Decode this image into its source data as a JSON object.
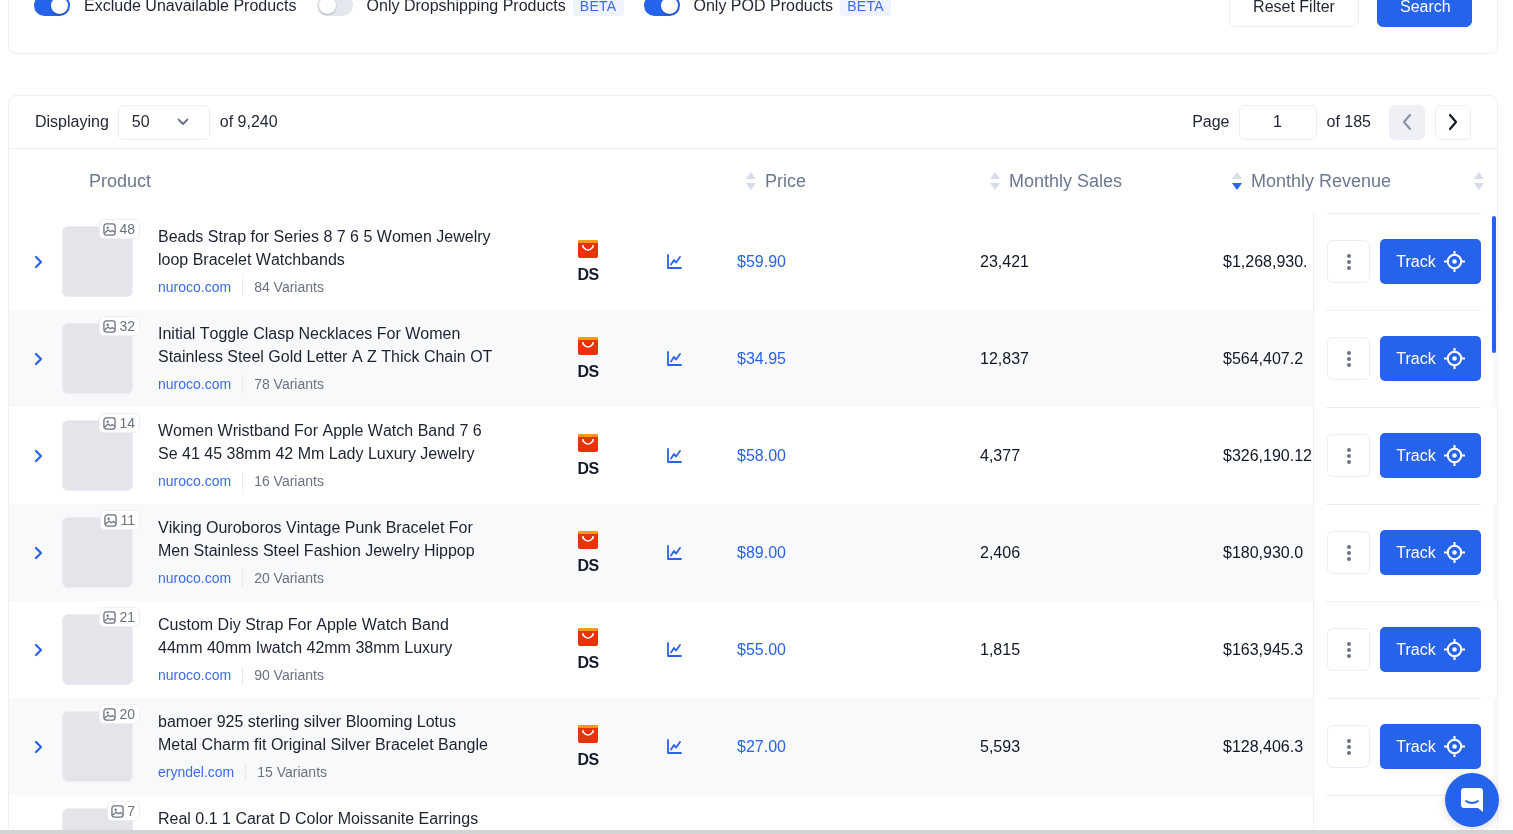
{
  "filters": {
    "toggles": [
      {
        "label": "Exclude Unavailable Products",
        "on": true
      },
      {
        "label": "Only Dropshipping Products",
        "on": false,
        "badge": "BETA"
      },
      {
        "label": "Only POD Products",
        "on": true,
        "badge": "BETA"
      }
    ],
    "buttons": [
      {
        "label": "Reset Filter",
        "kind": "secondary"
      },
      {
        "label": "Search",
        "kind": "primary"
      }
    ]
  },
  "results": {
    "displaying_label": "Displaying",
    "page_size": "50",
    "total": "of 9,240",
    "page_label": "Page",
    "page": "1",
    "page_total": "of 185",
    "prev": {
      "disabled": true
    },
    "next": {
      "disabled": false
    }
  },
  "table": {
    "columns": [
      {
        "label": "Product"
      },
      {
        "label": "Price",
        "sorted": false
      },
      {
        "label": "Monthly Sales",
        "sorted": false
      },
      {
        "label": "Monthly Revenue",
        "sorted": true
      },
      {
        "sorted": false
      }
    ],
    "rows": [
      {
        "expanded": false,
        "image_count": "48",
        "title": "Beads Strap for Series 8 7 6 5 Women Jewelry loop Bracelet Watchbands",
        "store": "nuroco.com",
        "variants": "84 Variants",
        "source": "DS",
        "price": "$59.90",
        "monthly_sales": "23,421",
        "monthly_revenue": "$1,268,930.",
        "track_label": "Track"
      },
      {
        "expanded": false,
        "image_count": "32",
        "title": "Initial Toggle Clasp Necklaces For Women Stainless Steel Gold Letter A Z Thick Chain OT",
        "store": "nuroco.com",
        "variants": "78 Variants",
        "source": "DS",
        "price": "$34.95",
        "monthly_sales": "12,837",
        "monthly_revenue": "$564,407.2",
        "track_label": "Track"
      },
      {
        "expanded": false,
        "image_count": "14",
        "title": "Women Wristband For Apple Watch Band 7 6 Se 41 45 38mm 42 Mm Lady Luxury Jewelry",
        "store": "nuroco.com",
        "variants": "16 Variants",
        "source": "DS",
        "price": "$58.00",
        "monthly_sales": "4,377",
        "monthly_revenue": "$326,190.12",
        "track_label": "Track"
      },
      {
        "expanded": false,
        "image_count": "11",
        "title": "Viking Ouroboros Vintage Punk Bracelet For Men Stainless Steel Fashion Jewelry Hippop",
        "store": "nuroco.com",
        "variants": "20 Variants",
        "source": "DS",
        "price": "$89.00",
        "monthly_sales": "2,406",
        "monthly_revenue": "$180,930.0",
        "track_label": "Track"
      },
      {
        "expanded": false,
        "image_count": "21",
        "title": "Custom Diy Strap For Apple Watch Band 44mm 40mm Iwatch 42mm 38mm Luxury",
        "store": "nuroco.com",
        "variants": "90 Variants",
        "source": "DS",
        "price": "$55.00",
        "monthly_sales": "1,815",
        "monthly_revenue": "$163,945.3",
        "track_label": "Track"
      },
      {
        "expanded": false,
        "image_count": "20",
        "title": "bamoer 925 sterling silver Blooming Lotus Metal Charm fit Original Silver Bracelet Bangle",
        "store": "eryndel.com",
        "variants": "15 Variants",
        "source": "DS",
        "price": "$27.00",
        "monthly_sales": "5,593",
        "monthly_revenue": "$128,406.3",
        "track_label": "Track"
      },
      {
        "image_count": "7",
        "title": "Real 0.1 1 Carat D Color Moissanite Earrings"
      }
    ]
  }
}
